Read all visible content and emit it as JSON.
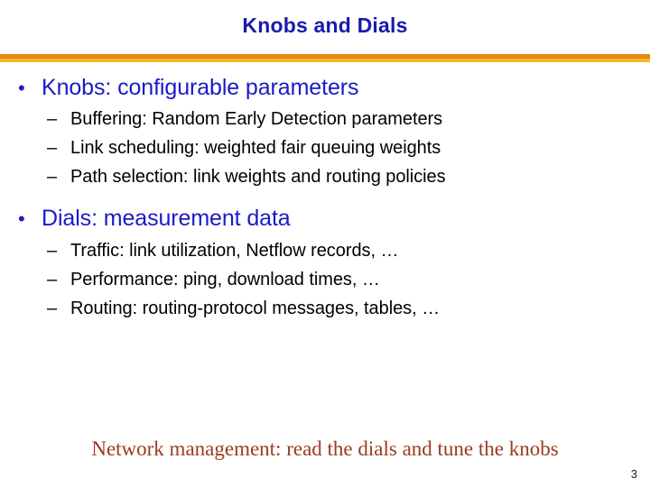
{
  "slide": {
    "title": "Knobs and Dials",
    "page_number": "3",
    "colors": {
      "title": "#1a1aaf",
      "bullet_level1": "#1a1ac8",
      "bullet_level2": "#000000",
      "rule_top": "#e8841a",
      "rule_bottom": "#f7bb1d",
      "takeaway": "#9c3a20",
      "background": "#ffffff"
    },
    "markers": {
      "level1": "•",
      "level2": "–"
    },
    "groups": [
      {
        "heading": "Knobs: configurable parameters",
        "items": [
          "Buffering: Random Early Detection parameters",
          "Link scheduling: weighted fair queuing weights",
          "Path selection: link weights and routing policies"
        ]
      },
      {
        "heading": "Dials:  measurement data",
        "items": [
          "Traffic: link utilization, Netflow records, …",
          "Performance: ping, download times, …",
          "Routing: routing-protocol messages, tables, …"
        ]
      }
    ],
    "takeaway": "Network management: read the dials and tune the knobs"
  }
}
